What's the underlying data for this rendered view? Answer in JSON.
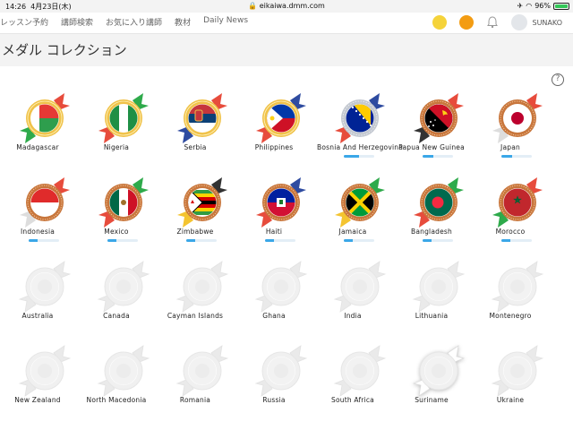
{
  "status": {
    "time": "14:26",
    "date": "4月23日(木)",
    "url": "eikaiwa.dmm.com",
    "battery": "96%"
  },
  "nav": {
    "links": [
      "レッスン予約",
      "講師検索",
      "お気に入り講師",
      "教材",
      "Daily News"
    ],
    "username": "SUNAKO"
  },
  "page": {
    "title": "メダル コレクション",
    "help": "?"
  },
  "colors": {
    "gold": "#f0c24a",
    "copper": "#c8763c",
    "silver": "#c8ccd3",
    "locked": "#eeeeee",
    "progress": "#3aa7e8"
  },
  "medals": [
    {
      "name": "Madagascar",
      "tier": "gold",
      "ribbon": [
        "#e74c3c",
        "#2eaa4b"
      ],
      "flag": "madagascar",
      "progress": null
    },
    {
      "name": "Nigeria",
      "tier": "gold",
      "ribbon": [
        "#2eaa4b",
        "#e74c3c"
      ],
      "flag": "nigeria",
      "progress": null
    },
    {
      "name": "Serbia",
      "tier": "gold",
      "ribbon": [
        "#e74c3c",
        "#2e4ba0"
      ],
      "flag": "serbia",
      "progress": null
    },
    {
      "name": "Philippines",
      "tier": "gold",
      "ribbon": [
        "#2e4ba0",
        "#e74c3c"
      ],
      "flag": "philippines",
      "progress": null
    },
    {
      "name": "Bosnia And Herzegovina",
      "tier": "silver",
      "ribbon": [
        "#2e4ba0",
        "#e74c3c"
      ],
      "flag": "bosnia",
      "progress": 0.5
    },
    {
      "name": "Papua New Guinea",
      "tier": "copper",
      "ribbon": [
        "#e74c3c",
        "#333333"
      ],
      "flag": "png",
      "progress": 0.35
    },
    {
      "name": "Japan",
      "tier": "copper",
      "ribbon": [
        "#e74c3c",
        "#dddddd"
      ],
      "flag": "japan",
      "progress": 0.35
    },
    {
      "name": "Indonesia",
      "tier": "copper",
      "ribbon": [
        "#e74c3c",
        "#dddddd"
      ],
      "flag": "indonesia",
      "progress": 0.3
    },
    {
      "name": "Mexico",
      "tier": "copper",
      "ribbon": [
        "#2eaa4b",
        "#e74c3c"
      ],
      "flag": "mexico",
      "progress": 0.3
    },
    {
      "name": "Zimbabwe",
      "tier": "copper",
      "ribbon": [
        "#333333",
        "#f4c430"
      ],
      "flag": "zimbabwe",
      "progress": 0.3
    },
    {
      "name": "Haiti",
      "tier": "copper",
      "ribbon": [
        "#2e4ba0",
        "#e74c3c"
      ],
      "flag": "haiti",
      "progress": 0.3
    },
    {
      "name": "Jamaica",
      "tier": "copper",
      "ribbon": [
        "#2eaa4b",
        "#f4c430"
      ],
      "flag": "jamaica",
      "progress": 0.3
    },
    {
      "name": "Bangladesh",
      "tier": "copper",
      "ribbon": [
        "#2eaa4b",
        "#e74c3c"
      ],
      "flag": "bangladesh",
      "progress": 0.3
    },
    {
      "name": "Morocco",
      "tier": "copper",
      "ribbon": [
        "#e74c3c",
        "#2eaa4b"
      ],
      "flag": "morocco",
      "progress": 0.3
    },
    {
      "name": "Australia",
      "tier": "locked",
      "ribbon": null,
      "flag": "locked",
      "progress": null
    },
    {
      "name": "Canada",
      "tier": "locked",
      "ribbon": null,
      "flag": "locked",
      "progress": null
    },
    {
      "name": "Cayman Islands",
      "tier": "locked",
      "ribbon": null,
      "flag": "locked",
      "progress": null
    },
    {
      "name": "Ghana",
      "tier": "locked",
      "ribbon": null,
      "flag": "locked",
      "progress": null
    },
    {
      "name": "India",
      "tier": "locked",
      "ribbon": null,
      "flag": "locked",
      "progress": null
    },
    {
      "name": "Lithuania",
      "tier": "locked",
      "ribbon": null,
      "flag": "locked",
      "progress": null
    },
    {
      "name": "Montenegro",
      "tier": "locked",
      "ribbon": null,
      "flag": "locked",
      "progress": null
    },
    {
      "name": "New Zealand",
      "tier": "locked",
      "ribbon": null,
      "flag": "locked",
      "progress": null
    },
    {
      "name": "North Macedonia",
      "tier": "locked",
      "ribbon": null,
      "flag": "locked",
      "progress": null
    },
    {
      "name": "Romania",
      "tier": "locked",
      "ribbon": null,
      "flag": "locked",
      "progress": null
    },
    {
      "name": "Russia",
      "tier": "locked",
      "ribbon": null,
      "flag": "locked",
      "progress": null
    },
    {
      "name": "South Africa",
      "tier": "locked",
      "ribbon": null,
      "flag": "locked",
      "progress": null
    },
    {
      "name": "Suriname",
      "tier": "locked-highlight",
      "ribbon": null,
      "flag": "locked",
      "progress": null
    },
    {
      "name": "Ukraine",
      "tier": "locked",
      "ribbon": null,
      "flag": "locked",
      "progress": null
    }
  ]
}
